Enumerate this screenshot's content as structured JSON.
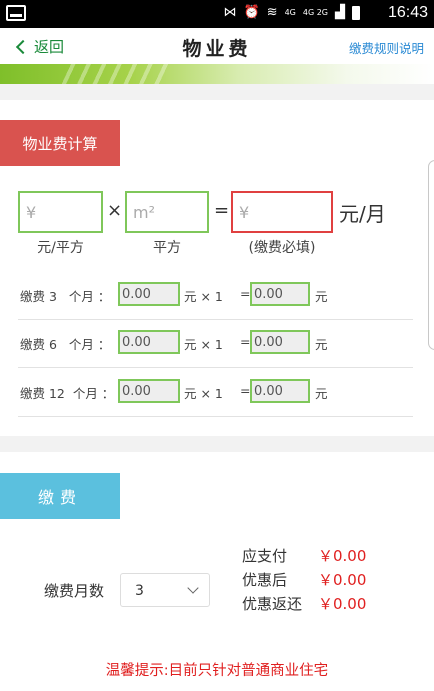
{
  "status_bar": {
    "time": "16:43",
    "network": "4G",
    "network2": "4G 2G"
  },
  "header": {
    "back_label": "返回",
    "title": "物业费",
    "rules_link": "缴费规则说明"
  },
  "calculator": {
    "section_label": "物业费计算",
    "price_placeholder": "¥",
    "area_placeholder": "m²",
    "total_placeholder": "¥",
    "multiply": "×",
    "equals": "=",
    "unit": "元/月",
    "price_label": "元/平方",
    "area_label": "平方",
    "total_label": "(缴费必填)"
  },
  "rows": [
    {
      "label": "缴费 3   个月 ：",
      "amount": "0.00",
      "multiplier": "元 × 1",
      "equals": "=",
      "result": "0.00",
      "unit": "元"
    },
    {
      "label": "缴费 6   个月 ：",
      "amount": "0.00",
      "multiplier": "元 × 1",
      "equals": "=",
      "result": "0.00",
      "unit": "元"
    },
    {
      "label": "缴费 12  个月 ：",
      "amount": "0.00",
      "multiplier": "元 × 1",
      "equals": "=",
      "result": "0.00",
      "unit": "元"
    }
  ],
  "payment": {
    "section_label": "缴费",
    "months_label": "缴费月数",
    "months_selected": "3",
    "due_label": "应支付",
    "due_value": "￥0.00",
    "discounted_label": "优惠后",
    "discounted_value": "￥0.00",
    "rebate_label": "优惠返还",
    "rebate_value": "￥0.00"
  },
  "tip": "温馨提示:目前只针对普通商业住宅",
  "colors": {
    "green_border": "#7fc75a",
    "red_border": "#e04040",
    "calc_label_bg": "#d9534f",
    "pay_label_bg": "#5bc0de",
    "price_red": "#e02020",
    "link_blue": "#2a8ad4"
  }
}
